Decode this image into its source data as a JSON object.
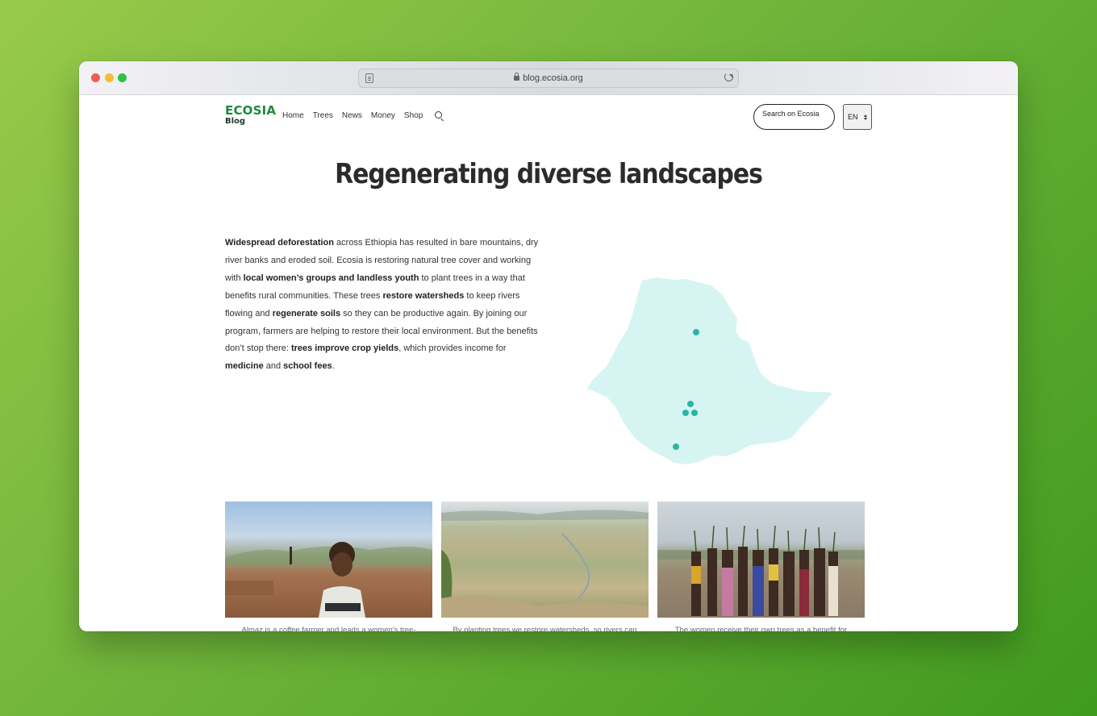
{
  "browser": {
    "url": "blog.ecosia.org"
  },
  "header": {
    "logo_main": "ECOSIA",
    "logo_sub": "Blog",
    "nav": [
      "Home",
      "Trees",
      "News",
      "Money",
      "Shop"
    ],
    "search_button": "Search on Ecosia",
    "language": "EN"
  },
  "main": {
    "title": "Regenerating diverse landscapes",
    "intro": [
      {
        "b": true,
        "t": "Widespread deforestation"
      },
      {
        "b": false,
        "t": " across Ethiopia has resulted in bare mountains, dry river banks and eroded soil. Ecosia is restoring natural tree cover and working with "
      },
      {
        "b": true,
        "t": "local women’s groups and landless youth"
      },
      {
        "b": false,
        "t": " to plant trees in a way that benefits rural communities. These trees "
      },
      {
        "b": true,
        "t": "restore watersheds"
      },
      {
        "b": false,
        "t": " to keep rivers flowing and "
      },
      {
        "b": true,
        "t": "regenerate soils"
      },
      {
        "b": false,
        "t": " so they can be productive again. By joining our program, farmers are helping to restore their local environment. But the benefits don’t stop there: "
      },
      {
        "b": true,
        "t": "trees improve crop yields"
      },
      {
        "b": false,
        "t": ", which provides income for "
      },
      {
        "b": true,
        "t": "medicine"
      },
      {
        "b": false,
        "t": " and "
      },
      {
        "b": true,
        "t": "school fees"
      },
      {
        "b": false,
        "t": "."
      }
    ],
    "map": {
      "fill_color": "#d6f5f2",
      "marker_color": "#2bb5a4"
    },
    "photos": [
      {
        "caption": "Almaz is a coffee farmer and leads a women's tree-planting group in Safa"
      },
      {
        "caption": "By planting trees we restore watersheds, so rivers can withstand the dry season"
      },
      {
        "caption": "The women receive their own trees as a benefit for participating in our programme"
      }
    ]
  }
}
